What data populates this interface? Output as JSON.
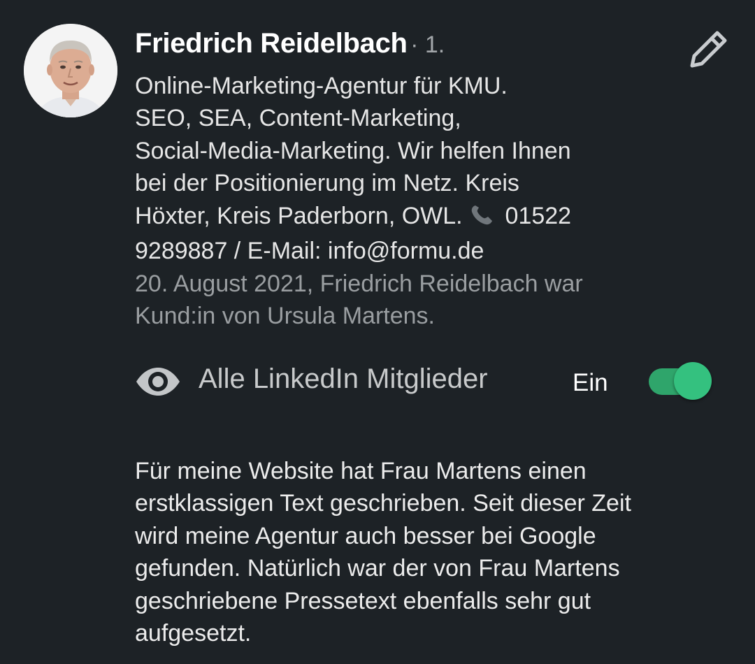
{
  "recommender": {
    "name": "Friedrich Reidelbach",
    "degree": "· 1.",
    "headline_lines": [
      "Online-Marketing-Agentur für KMU.",
      "SEO, SEA, Content-Marketing,",
      "Social-Media-Marketing. Wir helfen Ihnen",
      "bei der Positionierung im Netz. Kreis",
      "Höxter, Kreis Paderborn, OWL.",
      "9289887 / E-Mail: info@formu.de"
    ],
    "phone_suffix": " 01522",
    "meta_lines": [
      "20. August 2021, Friedrich Reidelbach war",
      "Kund:in von Ursula Martens."
    ]
  },
  "icons": {
    "avatar": "profile-photo",
    "edit": "pencil-icon",
    "phone": "telephone-receiver-emoji",
    "visibility": "eye-icon"
  },
  "visibility": {
    "label": "Alle LinkedIn Mitglieder",
    "state_label": "Ein",
    "enabled": true
  },
  "review_lines": [
    "Für meine Website hat Frau Martens einen",
    "erstklassigen Text geschrieben. Seit dieser Zeit",
    "wird meine Agentur auch besser bei Google",
    "gefunden. Natürlich war der von Frau Martens",
    "geschriebene Pressetext ebenfalls sehr gut",
    "aufgesetzt."
  ],
  "colors": {
    "background": "#1d2226",
    "toggle_on": "#34c17f",
    "secondary_text": "#9a9ea1"
  }
}
